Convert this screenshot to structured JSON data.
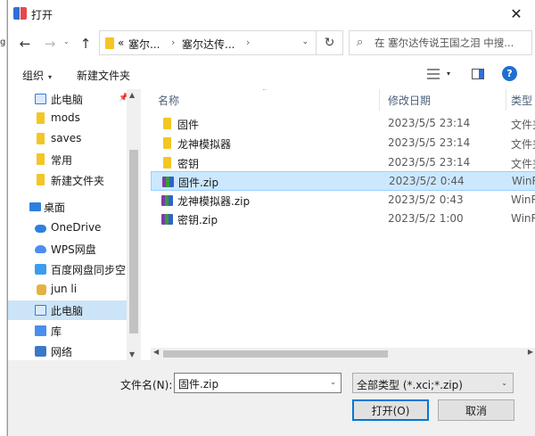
{
  "window": {
    "title": "打开",
    "close_glyph": "✕"
  },
  "background_edge_text": "g",
  "nav": {
    "back_glyph": "←",
    "forward_glyph": "→",
    "up_glyph": "↑",
    "recent_caret": "⌄",
    "address_prefix": "«",
    "crumbs": [
      "塞尔...",
      "塞尔达传..."
    ],
    "crumb_separator": "›",
    "address_dropdown": "⌄",
    "refresh_glyph": "↻",
    "search_glyph": "⌕",
    "search_placeholder": "在 塞尔达传说王国之泪 中搜..."
  },
  "toolbar": {
    "organize_label": "组织",
    "organize_caret": "▾",
    "new_folder_label": "新建文件夹",
    "view_caret": "▾",
    "help_glyph": "?"
  },
  "sidebar": {
    "pin_glyph": "📌",
    "items": [
      {
        "label": "此电脑",
        "icon": "pc-icon"
      },
      {
        "label": "mods",
        "icon": "folder-icon"
      },
      {
        "label": "saves",
        "icon": "folder-icon"
      },
      {
        "label": "常用",
        "icon": "folder-icon"
      },
      {
        "label": "新建文件夹",
        "icon": "folder-icon"
      },
      {
        "label": "桌面",
        "icon": "desktop-icon"
      },
      {
        "label": "OneDrive",
        "icon": "cloud-icon"
      },
      {
        "label": "WPS网盘",
        "icon": "wps-cloud-icon"
      },
      {
        "label": "百度网盘同步空间",
        "icon": "baidu-sync-icon"
      },
      {
        "label": "jun li",
        "icon": "user-folder-icon"
      },
      {
        "label": "此电脑",
        "icon": "pc-icon"
      },
      {
        "label": "库",
        "icon": "library-icon"
      },
      {
        "label": "网络",
        "icon": "network-icon"
      }
    ],
    "scroll_up": "▲",
    "scroll_down": "▼"
  },
  "filelist": {
    "columns": {
      "name": "名称",
      "date": "修改日期",
      "type": "类型"
    },
    "sort_glyph": "⌃",
    "rows": [
      {
        "name": "固件",
        "date": "2023/5/5 23:14",
        "type": "文件夹",
        "kind": "folder"
      },
      {
        "name": "龙神模拟器",
        "date": "2023/5/5 23:14",
        "type": "文件夹",
        "kind": "folder"
      },
      {
        "name": "密钥",
        "date": "2023/5/5 23:14",
        "type": "文件夹",
        "kind": "folder"
      },
      {
        "name": "固件.zip",
        "date": "2023/5/2 0:44",
        "type": "WinR",
        "kind": "zip"
      },
      {
        "name": "龙神模拟器.zip",
        "date": "2023/5/2 0:43",
        "type": "WinR",
        "kind": "zip"
      },
      {
        "name": "密钥.zip",
        "date": "2023/5/2 1:00",
        "type": "WinR",
        "kind": "zip"
      }
    ],
    "selected_index": 3,
    "scroll_left": "◀",
    "scroll_right": "▶"
  },
  "bottom": {
    "filename_label": "文件名(N):",
    "filename_value": "固件.zip",
    "filename_caret": "⌄",
    "filetype_value": "全部类型 (*.xci;*.zip)",
    "filetype_caret": "⌄",
    "open_label": "打开(O)",
    "cancel_label": "取消"
  },
  "colors": {
    "selection": "#cce8ff",
    "selection_border": "#99d1ff",
    "folder": "#f3c623",
    "accent": "#0078d7"
  }
}
